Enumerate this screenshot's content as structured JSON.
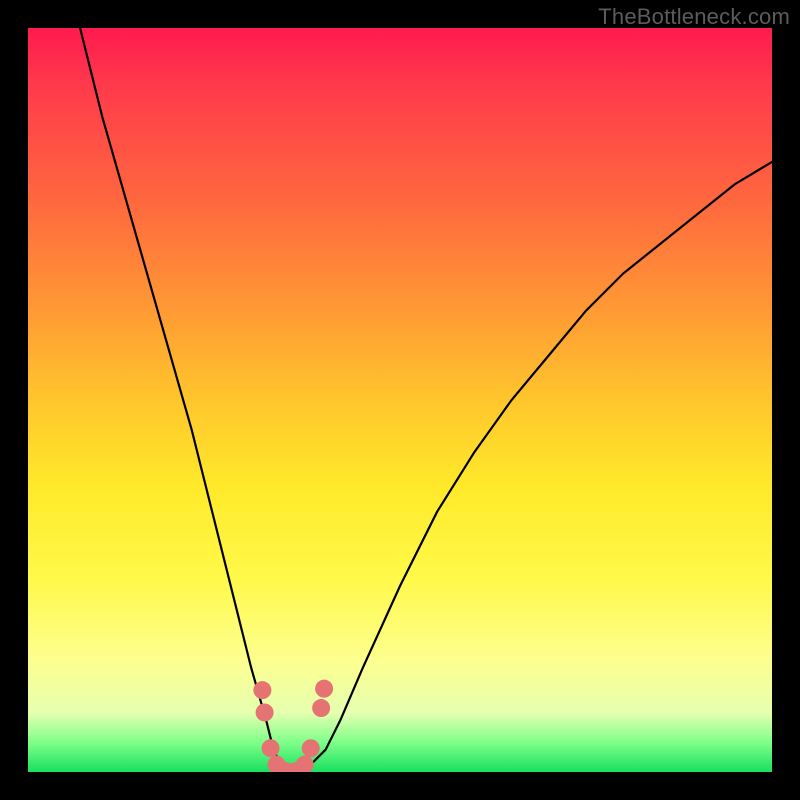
{
  "watermark": "TheBottleneck.com",
  "chart_data": {
    "type": "line",
    "title": "",
    "xlabel": "",
    "ylabel": "",
    "xlim": [
      0,
      100
    ],
    "ylim": [
      0,
      100
    ],
    "series": [
      {
        "name": "bottleneck-curve",
        "x": [
          7,
          10,
          14,
          18,
          22,
          25,
          28,
          30,
          32,
          33,
          34,
          35,
          36,
          37,
          38,
          40,
          42,
          45,
          50,
          55,
          60,
          65,
          70,
          75,
          80,
          85,
          90,
          95,
          100
        ],
        "y": [
          100,
          88,
          74,
          60,
          46,
          34,
          22,
          14,
          7,
          3,
          1,
          0,
          0,
          0,
          1,
          3,
          7,
          14,
          25,
          35,
          43,
          50,
          56,
          62,
          67,
          71,
          75,
          79,
          82
        ]
      }
    ],
    "markers": {
      "name": "highlight-dots",
      "color": "#e57373",
      "points": [
        {
          "x": 31.5,
          "y": 11
        },
        {
          "x": 31.8,
          "y": 8
        },
        {
          "x": 32.6,
          "y": 3.2
        },
        {
          "x": 33.4,
          "y": 1.0
        },
        {
          "x": 34.3,
          "y": 0.2
        },
        {
          "x": 35.3,
          "y": 0.0
        },
        {
          "x": 36.3,
          "y": 0.2
        },
        {
          "x": 37.2,
          "y": 1.0
        },
        {
          "x": 38.0,
          "y": 3.2
        },
        {
          "x": 39.4,
          "y": 8.6
        },
        {
          "x": 39.8,
          "y": 11.2
        }
      ]
    },
    "gradient_stops": [
      {
        "pos": 0,
        "color": "#ff1a4f"
      },
      {
        "pos": 50,
        "color": "#ffc62c"
      },
      {
        "pos": 85,
        "color": "#fdff8f"
      },
      {
        "pos": 100,
        "color": "#18e060"
      }
    ]
  }
}
